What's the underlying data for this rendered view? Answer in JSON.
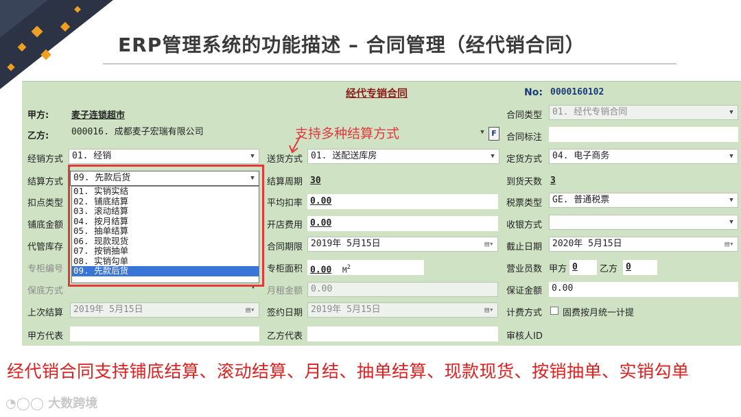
{
  "slide": {
    "title": "ERP管理系统的功能描述 – 合同管理（经代销合同）",
    "bottom_text": "经代销合同支持铺底结算、滚动结算、月结、抽单结算、现款现货、按销抽单、实销勾单",
    "watermark": "大数跨境",
    "callout": "支持多种结算方式"
  },
  "form": {
    "title": "经代专销合同",
    "no_label": "No:",
    "no_value": "0000160102",
    "party_a_label": "甲方:",
    "party_a_value": "麦子连锁超市",
    "party_b_label": "乙方:",
    "party_b_value": "000016. 成都麦子宏瑞有限公司",
    "f_button": "F",
    "contract_type_label": "合同类型",
    "contract_type_value": "01. 经代专销合同",
    "contract_mark_label": "合同标注",
    "dist_mode_label": "经销方式",
    "dist_mode_value": "01. 经销",
    "delivery_mode_label": "送货方式",
    "delivery_mode_value": "01. 送配送库房",
    "order_mode_label": "定货方式",
    "order_mode_value": "04. 电子商务",
    "settle_mode_label": "结算方式",
    "settle_mode_value": "09. 先款后货",
    "settle_cycle_label": "结算周期",
    "settle_cycle_value": "30",
    "arrival_days_label": "到货天数",
    "arrival_days_value": "3",
    "deduct_type_label": "扣点类型",
    "avg_deduct_label": "平均扣率",
    "avg_deduct_value": "0.00",
    "tax_type_label": "税票类型",
    "tax_type_value": "GE. 普通税票",
    "base_amount_label": "铺底金额",
    "open_fee_label": "开店费用",
    "open_fee_value": "0.00",
    "pay_mode_label": "收银方式",
    "consign_label": "代管库存",
    "period_label": "合同期限",
    "period_value": "2019年 5月15日",
    "deadline_label": "截止日期",
    "deadline_value": "2020年 5月15日",
    "counter_no_label": "专柜编号",
    "counter_area_label": "专柜面积",
    "counter_area_value": "0.00",
    "area_unit": "M",
    "area_exp": "2",
    "sales_staff_label": "营业员数",
    "party_a_short": "甲方",
    "party_a_staff": "0",
    "party_b_short": "乙方",
    "party_b_staff": "0",
    "guarantee_label": "保底方式",
    "monthly_rent_label": "月租金额",
    "monthly_rent_value": "0.00",
    "deposit_label": "保证金额",
    "deposit_value": "0.00",
    "last_settle_label": "上次结算",
    "last_settle_value": "2019年 5月15日",
    "sign_date_label": "签约日期",
    "sign_date_value": "2019年 5月15日",
    "billing_label": "计费方式",
    "billing_checkbox": "固费按月统一计提",
    "party_a_rep_label": "甲方代表",
    "party_b_rep_label": "乙方代表",
    "auditor_label": "审核人ID"
  },
  "dropdown": {
    "options": [
      "01. 实销实结",
      "02. 铺底结算",
      "03. 滚动结算",
      "04. 按月结算",
      "05. 抽单结算",
      "06. 现款现货",
      "07. 按销抽单",
      "08. 实销勾单",
      "09. 先款后货"
    ],
    "selected_index": 8
  },
  "colors": {
    "panel": "#cfe3c4",
    "accent_red": "#e03a3a",
    "selection": "#3875d7",
    "title_red": "#8b1a1a"
  }
}
